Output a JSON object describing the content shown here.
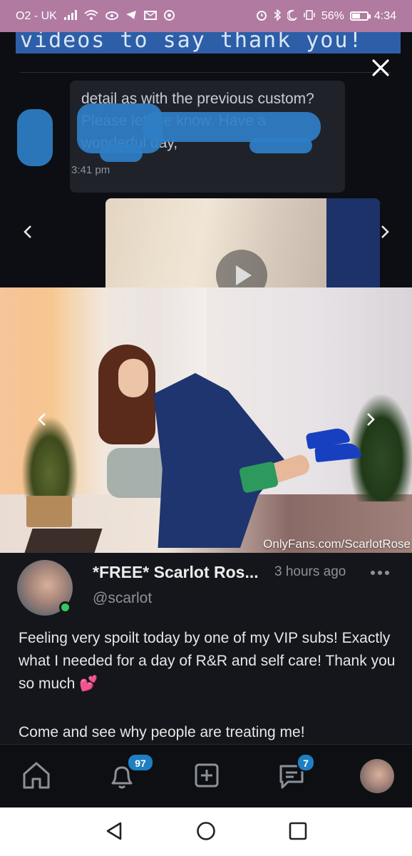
{
  "status_bar": {
    "carrier": "O2 - UK",
    "battery_percent": "56%",
    "battery_level": 0.56,
    "time": "4:34",
    "icons": [
      "signal-icon",
      "wifi-icon",
      "eye-icon",
      "telegram-icon",
      "mail-icon",
      "chrome-icon",
      "alarm-icon",
      "bluetooth-icon",
      "moon-icon",
      "vibrate-icon",
      "battery-icon"
    ]
  },
  "media_viewer": {
    "close_icon": "close-icon",
    "prev_icon": "chevron-left-icon",
    "next_icon": "chevron-right-icon",
    "screenshot": {
      "header_text": "videos to say thank you!",
      "message_text": "detail as with the previous custom? Please let me know. Have a wonderful day,",
      "message_time": "3:41 pm"
    },
    "watermark": "OnlyFans.com/ScarlotRose"
  },
  "post": {
    "author_name": "*FREE* Scarlot Ros...",
    "handle": "@scarlot",
    "time": "3 hours ago",
    "more_icon": "more-icon",
    "online": true,
    "body_line": "Feeling very spoilt today by one of my VIP subs! Exactly what I needed for a day of R&R and self care! Thank you so much",
    "body_emoji": "💕",
    "body_line2": "Come and see why people are treating me!"
  },
  "bottom_nav": {
    "home_icon": "home-icon",
    "notifications_icon": "bell-icon",
    "notifications_count": "97",
    "add_icon": "add-post-icon",
    "messages_icon": "messages-icon",
    "messages_count": "7",
    "profile_icon": "avatar"
  },
  "android_nav": {
    "back_icon": "back-icon",
    "home_icon": "home-circle-icon",
    "recents_icon": "recents-icon"
  },
  "colors": {
    "status_bar": "#b07aa1",
    "badge": "#1e7fc2",
    "online": "#34c759"
  }
}
